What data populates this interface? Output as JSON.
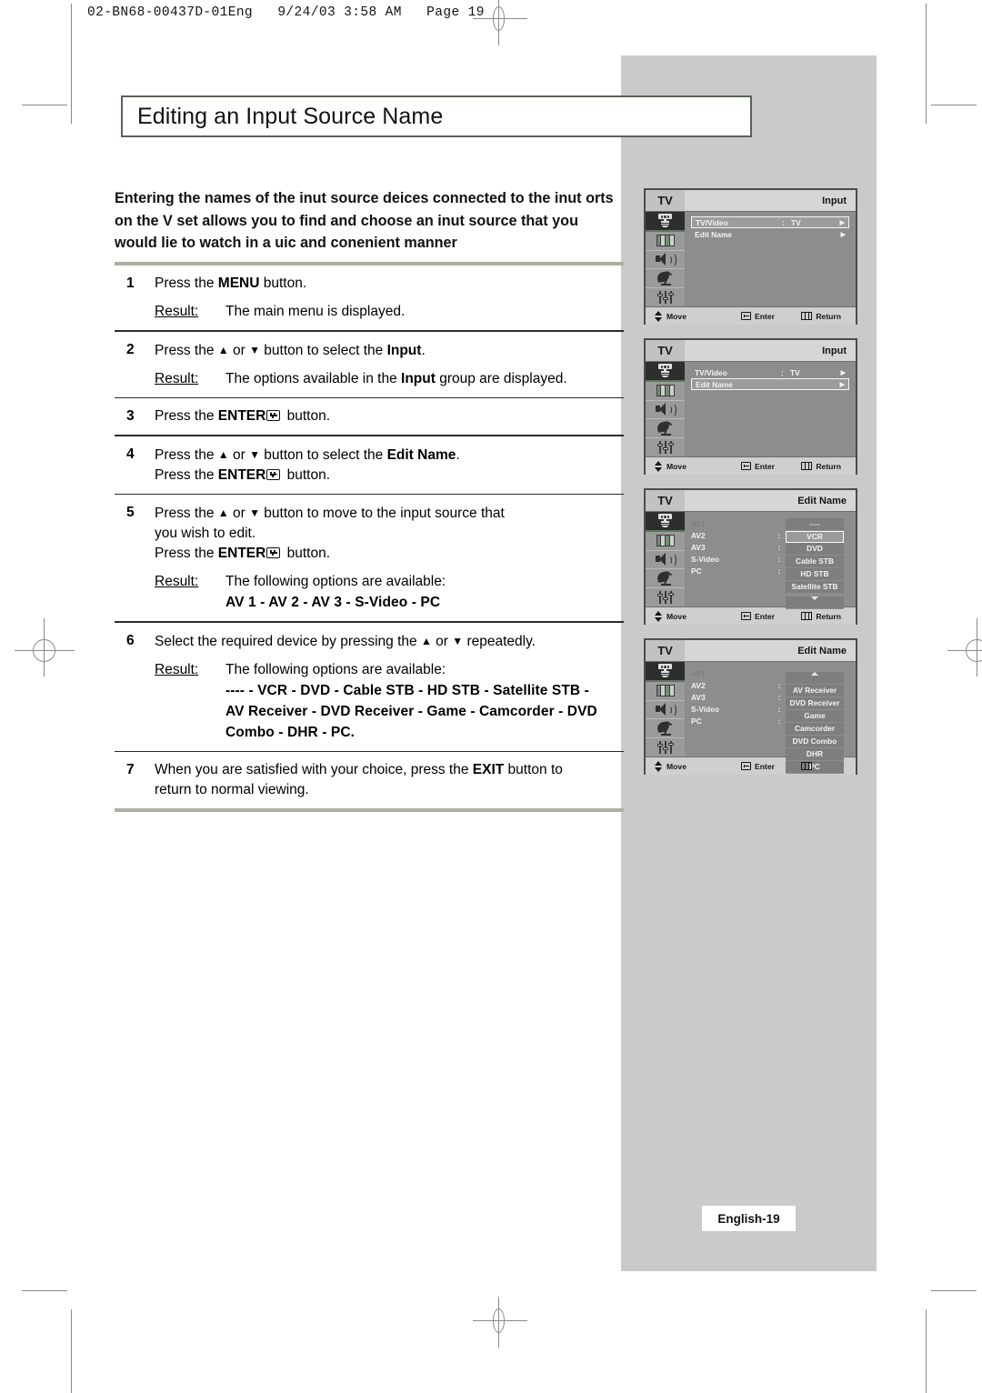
{
  "doc_header": "02-BN68-00437D-01Eng   9/24/03 3:58 AM   Page 19",
  "title": "Editing an Input Source Name",
  "intro": "Entering the names of the inut source deices connected to the inut orts on the V set allows you to find and choose an inut source that you would lie to watch in a uic and conenient manner",
  "steps": [
    {
      "num": "1",
      "lines": [
        "Press the ",
        "MENU",
        " button."
      ],
      "text_pre": "Press the ",
      "text_bold": "MENU",
      "text_post": " button.",
      "result_label": "Result:",
      "result_text": "The main menu is displayed."
    },
    {
      "num": "2",
      "text_pre": "Press the ",
      "text_bold": "Input",
      "text_post": ".",
      "result_label": "Result:",
      "result_text": "The options available in the Input group are displayed."
    },
    {
      "num": "3",
      "text_pre": "Press the ",
      "text_bold": "ENTER",
      "text_post": " button."
    },
    {
      "num": "4",
      "text_bold": "Edit Name",
      "line2": "Press the ENTER button."
    },
    {
      "num": "5",
      "line1": "Press the   or   button to move to the input source that",
      "line2": "you wish to edit.",
      "line3": "Press the ENTER button.",
      "result_label": "Result:",
      "result_text": "The following options are available:",
      "options": "AV 1 - AV 2 - AV 3 - S-Video - PC"
    },
    {
      "num": "6",
      "line1": "Select the required device by pressing the   or   repeatedly.",
      "result_label": "Result:",
      "result_text": "The following options are available:",
      "options_line1": "---- - VCR - DVD - Cable STB - HD STB - Satellite STB -",
      "options_line2": "AV Receiver - DVD Receiver - Game - Camcorder - DVD",
      "options_line3": "Combo - DHR - PC."
    },
    {
      "num": "7",
      "line1_pre": "When you are satisfied with your choice, press the ",
      "line1_bold": "EXIT",
      "line1_post": " button to",
      "line2": "return to normal viewing."
    }
  ],
  "step_words": {
    "press_the": "Press the ",
    "or": " or ",
    "button_to_select_the": " button to select the ",
    "button": " button.",
    "period": ".",
    "result": "Result:"
  },
  "osd_panels": [
    {
      "id": "panel-1",
      "brand": "TV",
      "title": "Input",
      "type": "menu",
      "rows": [
        {
          "label": "TV/Video",
          "colon": ":",
          "value": "TV",
          "arrow": "▶",
          "highlighted": true
        },
        {
          "label": "Edit Name",
          "colon": "",
          "value": "",
          "arrow": "▶",
          "highlighted": false
        }
      ],
      "footer": {
        "move": "Move",
        "enter": "Enter",
        "return": "Return"
      }
    },
    {
      "id": "panel-2",
      "brand": "TV",
      "title": "Input",
      "type": "menu",
      "rows": [
        {
          "label": "TV/Video",
          "colon": ":",
          "value": "TV",
          "arrow": "▶",
          "highlighted": false
        },
        {
          "label": "Edit Name",
          "colon": "",
          "value": "",
          "arrow": "▶",
          "highlighted": true
        }
      ],
      "footer": {
        "move": "Move",
        "enter": "Enter",
        "return": "Return"
      }
    },
    {
      "id": "panel-3",
      "brand": "TV",
      "title": "Edit Name",
      "type": "editname",
      "sources": [
        {
          "name": "AV1",
          "dim": true
        },
        {
          "name": "AV2",
          "dim": false
        },
        {
          "name": "AV3",
          "dim": false
        },
        {
          "name": "S-Video",
          "dim": false
        },
        {
          "name": "PC",
          "dim": false
        }
      ],
      "options": [
        {
          "text": "----",
          "selected": false,
          "dim": true
        },
        {
          "text": "VCR",
          "selected": true,
          "dim": false
        },
        {
          "text": "DVD",
          "selected": false,
          "dim": false
        },
        {
          "text": "Cable STB",
          "selected": false,
          "dim": false
        },
        {
          "text": "HD STB",
          "selected": false,
          "dim": false
        },
        {
          "text": "Satellite STB",
          "selected": false,
          "dim": false
        }
      ],
      "scroll": "down",
      "footer": {
        "move": "Move",
        "enter": "Enter",
        "return": "Return"
      }
    },
    {
      "id": "panel-4",
      "brand": "TV",
      "title": "Edit Name",
      "type": "editname",
      "sources": [
        {
          "name": "AV1",
          "dim": true
        },
        {
          "name": "AV2",
          "dim": false
        },
        {
          "name": "AV3",
          "dim": false
        },
        {
          "name": "S-Video",
          "dim": false
        },
        {
          "name": "PC",
          "dim": false
        }
      ],
      "options": [
        {
          "text": "AV Receiver",
          "selected": false,
          "dim": false
        },
        {
          "text": "DVD Receiver",
          "selected": false,
          "dim": false
        },
        {
          "text": "Game",
          "selected": false,
          "dim": false
        },
        {
          "text": "Camcorder",
          "selected": false,
          "dim": false
        },
        {
          "text": "DVD Combo",
          "selected": false,
          "dim": false
        },
        {
          "text": "DHR",
          "selected": false,
          "dim": false
        },
        {
          "text": "PC",
          "selected": false,
          "dim": false
        }
      ],
      "scroll": "up",
      "footer": {
        "move": "Move",
        "enter": "Enter",
        "return": "Return"
      }
    }
  ],
  "osd_sidebar_icons": [
    "input-icon",
    "picture-icon",
    "sound-icon",
    "satellite-dish-icon",
    "setup-icon"
  ],
  "page_badge": "English-19",
  "colors": {
    "rule": "#a9b2a4",
    "title_border": "#5a6356",
    "gray_panel": "#cacaca",
    "osd_body": "#8d8d8d",
    "osd_selected_icon": "#2e2e2e"
  }
}
